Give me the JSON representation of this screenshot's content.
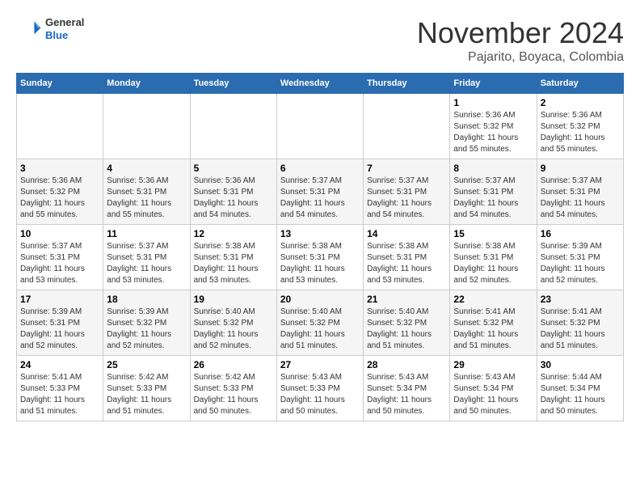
{
  "header": {
    "logo": {
      "general": "General",
      "blue": "Blue"
    },
    "title": "November 2024",
    "location": "Pajarito, Boyaca, Colombia"
  },
  "weekdays": [
    "Sunday",
    "Monday",
    "Tuesday",
    "Wednesday",
    "Thursday",
    "Friday",
    "Saturday"
  ],
  "weeks": [
    [
      {
        "day": "",
        "info": ""
      },
      {
        "day": "",
        "info": ""
      },
      {
        "day": "",
        "info": ""
      },
      {
        "day": "",
        "info": ""
      },
      {
        "day": "",
        "info": ""
      },
      {
        "day": "1",
        "info": "Sunrise: 5:36 AM\nSunset: 5:32 PM\nDaylight: 11 hours\nand 55 minutes."
      },
      {
        "day": "2",
        "info": "Sunrise: 5:36 AM\nSunset: 5:32 PM\nDaylight: 11 hours\nand 55 minutes."
      }
    ],
    [
      {
        "day": "3",
        "info": "Sunrise: 5:36 AM\nSunset: 5:32 PM\nDaylight: 11 hours\nand 55 minutes."
      },
      {
        "day": "4",
        "info": "Sunrise: 5:36 AM\nSunset: 5:31 PM\nDaylight: 11 hours\nand 55 minutes."
      },
      {
        "day": "5",
        "info": "Sunrise: 5:36 AM\nSunset: 5:31 PM\nDaylight: 11 hours\nand 54 minutes."
      },
      {
        "day": "6",
        "info": "Sunrise: 5:37 AM\nSunset: 5:31 PM\nDaylight: 11 hours\nand 54 minutes."
      },
      {
        "day": "7",
        "info": "Sunrise: 5:37 AM\nSunset: 5:31 PM\nDaylight: 11 hours\nand 54 minutes."
      },
      {
        "day": "8",
        "info": "Sunrise: 5:37 AM\nSunset: 5:31 PM\nDaylight: 11 hours\nand 54 minutes."
      },
      {
        "day": "9",
        "info": "Sunrise: 5:37 AM\nSunset: 5:31 PM\nDaylight: 11 hours\nand 54 minutes."
      }
    ],
    [
      {
        "day": "10",
        "info": "Sunrise: 5:37 AM\nSunset: 5:31 PM\nDaylight: 11 hours\nand 53 minutes."
      },
      {
        "day": "11",
        "info": "Sunrise: 5:37 AM\nSunset: 5:31 PM\nDaylight: 11 hours\nand 53 minutes."
      },
      {
        "day": "12",
        "info": "Sunrise: 5:38 AM\nSunset: 5:31 PM\nDaylight: 11 hours\nand 53 minutes."
      },
      {
        "day": "13",
        "info": "Sunrise: 5:38 AM\nSunset: 5:31 PM\nDaylight: 11 hours\nand 53 minutes."
      },
      {
        "day": "14",
        "info": "Sunrise: 5:38 AM\nSunset: 5:31 PM\nDaylight: 11 hours\nand 53 minutes."
      },
      {
        "day": "15",
        "info": "Sunrise: 5:38 AM\nSunset: 5:31 PM\nDaylight: 11 hours\nand 52 minutes."
      },
      {
        "day": "16",
        "info": "Sunrise: 5:39 AM\nSunset: 5:31 PM\nDaylight: 11 hours\nand 52 minutes."
      }
    ],
    [
      {
        "day": "17",
        "info": "Sunrise: 5:39 AM\nSunset: 5:31 PM\nDaylight: 11 hours\nand 52 minutes."
      },
      {
        "day": "18",
        "info": "Sunrise: 5:39 AM\nSunset: 5:32 PM\nDaylight: 11 hours\nand 52 minutes."
      },
      {
        "day": "19",
        "info": "Sunrise: 5:40 AM\nSunset: 5:32 PM\nDaylight: 11 hours\nand 52 minutes."
      },
      {
        "day": "20",
        "info": "Sunrise: 5:40 AM\nSunset: 5:32 PM\nDaylight: 11 hours\nand 51 minutes."
      },
      {
        "day": "21",
        "info": "Sunrise: 5:40 AM\nSunset: 5:32 PM\nDaylight: 11 hours\nand 51 minutes."
      },
      {
        "day": "22",
        "info": "Sunrise: 5:41 AM\nSunset: 5:32 PM\nDaylight: 11 hours\nand 51 minutes."
      },
      {
        "day": "23",
        "info": "Sunrise: 5:41 AM\nSunset: 5:32 PM\nDaylight: 11 hours\nand 51 minutes."
      }
    ],
    [
      {
        "day": "24",
        "info": "Sunrise: 5:41 AM\nSunset: 5:33 PM\nDaylight: 11 hours\nand 51 minutes."
      },
      {
        "day": "25",
        "info": "Sunrise: 5:42 AM\nSunset: 5:33 PM\nDaylight: 11 hours\nand 51 minutes."
      },
      {
        "day": "26",
        "info": "Sunrise: 5:42 AM\nSunset: 5:33 PM\nDaylight: 11 hours\nand 50 minutes."
      },
      {
        "day": "27",
        "info": "Sunrise: 5:43 AM\nSunset: 5:33 PM\nDaylight: 11 hours\nand 50 minutes."
      },
      {
        "day": "28",
        "info": "Sunrise: 5:43 AM\nSunset: 5:34 PM\nDaylight: 11 hours\nand 50 minutes."
      },
      {
        "day": "29",
        "info": "Sunrise: 5:43 AM\nSunset: 5:34 PM\nDaylight: 11 hours\nand 50 minutes."
      },
      {
        "day": "30",
        "info": "Sunrise: 5:44 AM\nSunset: 5:34 PM\nDaylight: 11 hours\nand 50 minutes."
      }
    ]
  ]
}
